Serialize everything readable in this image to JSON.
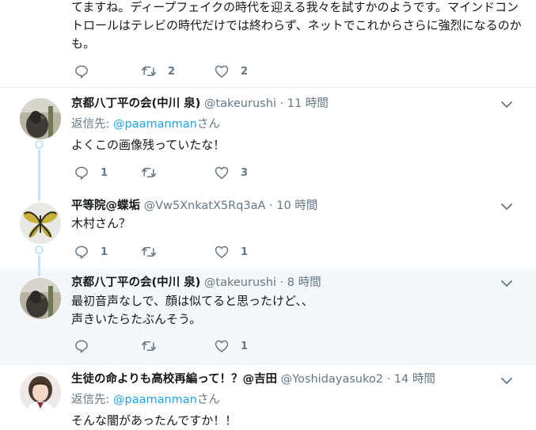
{
  "tweets": [
    {
      "text": "てますね。ディープフェイクの時代を迎える我々を試すかのようです。マインドコントロールはテレビの時代だけでは終わらず、ネットでこれからさらに強烈になるのかも。",
      "actions": {
        "replies": "",
        "retweets": "2",
        "likes": "2"
      }
    },
    {
      "name": "京都八丁平の会(中川 泉)",
      "handle": "@takeurushi",
      "dot": "·",
      "time": "11 時間",
      "reply_label": "返信先: ",
      "reply_mention": "@paamanman",
      "reply_suffix": "さん",
      "text": "よくこの画像残っていたな！",
      "actions": {
        "replies": "1",
        "retweets": "",
        "likes": "3"
      }
    },
    {
      "name": "平等院@蝶垢",
      "handle": "@Vw5XnkatX5Rq3aA",
      "dot": "·",
      "time": "10 時間",
      "text": "木村さん？",
      "actions": {
        "replies": "1",
        "retweets": "",
        "likes": "1"
      }
    },
    {
      "name": "京都八丁平の会(中川 泉)",
      "handle": "@takeurushi",
      "dot": "·",
      "time": "8 時間",
      "text": "最初音声なしで、顔は似てると思ったけど、、\n声きいたらたぶんそう。",
      "actions": {
        "replies": "",
        "retweets": "",
        "likes": "1"
      }
    },
    {
      "name": "生徒の命よりも高校再編って！？@吉田",
      "handle": "@Yoshidayasuko2",
      "dot": "·",
      "time": "14 時間",
      "reply_label": "返信先: ",
      "reply_mention": "@paamanman",
      "reply_suffix": "さん",
      "text": "そんな闇があったんですか！！"
    }
  ],
  "colors": {
    "text": "#14171a",
    "secondary": "#657786",
    "accent": "#1da1f2",
    "thread": "#c6e3f6",
    "highlight_bg": "#f5f8fa",
    "divider": "#e6ecf0"
  },
  "icons": {
    "reply": "reply-icon",
    "retweet": "retweet-icon",
    "like": "heart-icon",
    "more": "chevron-down-icon"
  }
}
